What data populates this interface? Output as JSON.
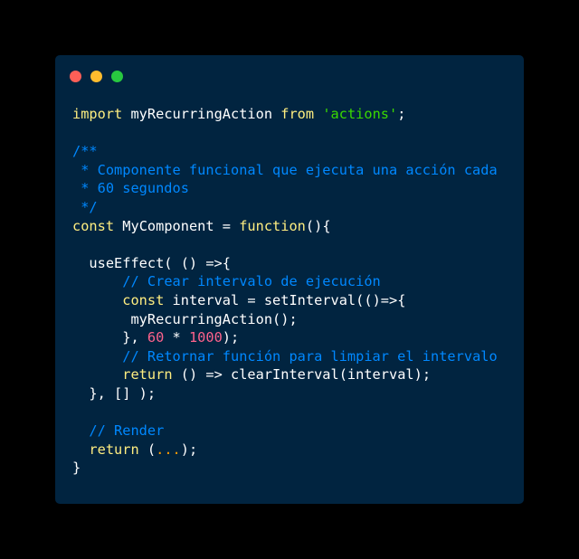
{
  "theme": {
    "background": "#000000",
    "window_background": "#012440"
  },
  "window_controls": [
    {
      "name": "close-dot",
      "color": "#ff5f57"
    },
    {
      "name": "minimize-dot",
      "color": "#febc2e"
    },
    {
      "name": "maximize-dot",
      "color": "#28c840"
    }
  ],
  "code": {
    "language": "javascript",
    "lines": [
      [
        [
          "import",
          "#ffee80"
        ],
        [
          " myRecurringAction ",
          "#ffffff"
        ],
        [
          "from",
          "#ffee80"
        ],
        [
          " ",
          "#ffffff"
        ],
        [
          "'actions'",
          "#3ad900"
        ],
        [
          ";",
          "#ffffff"
        ]
      ],
      [],
      [
        [
          "/**",
          "#0088ff"
        ]
      ],
      [
        [
          " * Componente funcional que ejecuta una acción cada",
          "#0088ff"
        ]
      ],
      [
        [
          " * 60 segundos",
          "#0088ff"
        ]
      ],
      [
        [
          " */",
          "#0088ff"
        ]
      ],
      [
        [
          "const",
          "#ffee80"
        ],
        [
          " MyComponent = ",
          "#ffffff"
        ],
        [
          "function",
          "#ffee80"
        ],
        [
          "(){",
          "#ffffff"
        ]
      ],
      [],
      [
        [
          "  useEffect( () =>{",
          "#ffffff"
        ]
      ],
      [
        [
          "      ",
          "#ffffff"
        ],
        [
          "// Crear intervalo de ejecución",
          "#0088ff"
        ]
      ],
      [
        [
          "      ",
          "#ffffff"
        ],
        [
          "const",
          "#ffee80"
        ],
        [
          " interval = setInterval(()=>{",
          "#ffffff"
        ]
      ],
      [
        [
          "       myRecurringAction();",
          "#ffffff"
        ]
      ],
      [
        [
          "      }, ",
          "#ffffff"
        ],
        [
          "60",
          "#ff628c"
        ],
        [
          " * ",
          "#ffffff"
        ],
        [
          "1000",
          "#ff628c"
        ],
        [
          ");",
          "#ffffff"
        ]
      ],
      [
        [
          "      ",
          "#ffffff"
        ],
        [
          "// Retornar función para limpiar el intervalo",
          "#0088ff"
        ]
      ],
      [
        [
          "      ",
          "#ffffff"
        ],
        [
          "return",
          "#ffee80"
        ],
        [
          " () => clearInterval(interval);",
          "#ffffff"
        ]
      ],
      [
        [
          "  }, [] );",
          "#ffffff"
        ]
      ],
      [],
      [
        [
          "  ",
          "#ffffff"
        ],
        [
          "// Render",
          "#0088ff"
        ]
      ],
      [
        [
          "  ",
          "#ffffff"
        ],
        [
          "return",
          "#ffee80"
        ],
        [
          " (",
          "#ffffff"
        ],
        [
          "...",
          "#ff9d00"
        ],
        [
          ");",
          "#ffffff"
        ]
      ],
      [
        [
          "}",
          "#ffffff"
        ]
      ]
    ]
  }
}
